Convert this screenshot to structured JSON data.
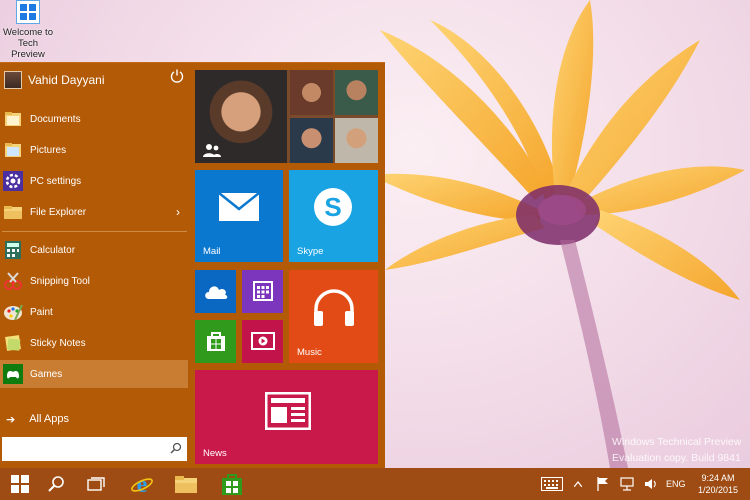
{
  "desktop": {
    "icon_label": "Welcome to Tech Preview"
  },
  "user": {
    "name": "Vahid Dayyani"
  },
  "menu": {
    "items": [
      {
        "label": "Documents",
        "icon": "folder-icon"
      },
      {
        "label": "Pictures",
        "icon": "folder-icon"
      },
      {
        "label": "PC settings",
        "icon": "gear-icon"
      },
      {
        "label": "File Explorer",
        "icon": "folder-icon"
      },
      {
        "label": "Calculator",
        "icon": "calculator-icon"
      },
      {
        "label": "Snipping Tool",
        "icon": "scissors-icon"
      },
      {
        "label": "Paint",
        "icon": "palette-icon"
      },
      {
        "label": "Sticky Notes",
        "icon": "note-icon"
      },
      {
        "label": "Games",
        "icon": "gamepad-icon"
      }
    ],
    "all_apps": "All Apps"
  },
  "tiles": {
    "mail": "Mail",
    "skype": "Skype",
    "music": "Music",
    "news": "News"
  },
  "watermark": {
    "line1": "Windows Technical Preview",
    "line2": "Evaluation copy. Build 9841"
  },
  "tray": {
    "language": "ENG",
    "time": "9:24 AM",
    "date": "1/20/2015"
  },
  "colors": {
    "start_bg": "#b35a06",
    "taskbar_bg": "#9e4c14",
    "mail": "#0b78cf",
    "skype": "#19a3e3",
    "music": "#e24b16",
    "news": "#c9184a"
  }
}
